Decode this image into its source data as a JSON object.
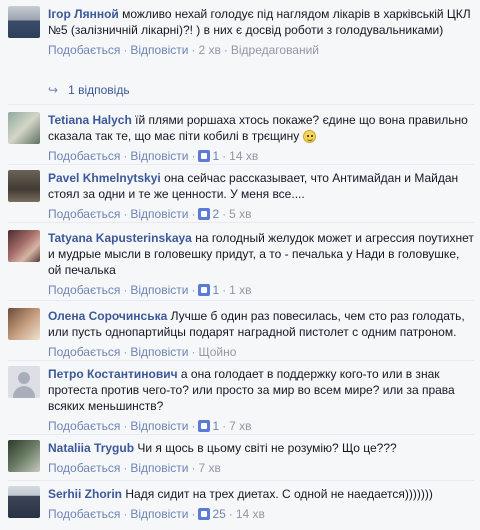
{
  "labels": {
    "like": "Подобається",
    "reply": "Відповісти",
    "dot": "·",
    "edited": "Відредагований"
  },
  "replies_link": "1 відповідь",
  "comments": [
    {
      "author": "Ігор Лянной",
      "text": "можливо нехай голодує під наглядом лікарів в харківській ЦКЛ №5 (залізничній лікарні)?! ) в них є досвід роботи з голодувальниками)",
      "time": "2 хв",
      "likes": "",
      "edited": true
    },
    {
      "author": "Tetiana Halych",
      "text": "їй плями роршаха хтось покаже? єдине що вона правильно сказала так те, що має піти кобилі в трєщину",
      "emoji": "smile-emoji",
      "time": "14 хв",
      "likes": "1"
    },
    {
      "author": "Pavel Khmelnytskyi",
      "text": "она сейчас рассказывает, что Антимайдан и Майдан стоял за одни и те же ценности. У меня все....",
      "time": "5 хв",
      "likes": "2"
    },
    {
      "author": "Tatyana Kapusterinskaya",
      "text": "на голодный желудок может и агрессия поутихнет и мудрые мысли в головешку придут, а то - печалька у Нади в головушке, ой печалька",
      "time": "1 хв",
      "likes": "1"
    },
    {
      "author": "Олена Сорочинська",
      "text": "Лучше б один раз повесилась, чем сто раз голодать, или пусть однопартийцы подарят наградной пистолет с одним патроном.",
      "time": "Щойно",
      "likes": ""
    },
    {
      "author": "Петро Костантинович",
      "text": "а она голодает в поддержку кого-то или в знак протеста против чего-то? или просто за мир во всем мире? или за права всяких меньшинств?",
      "time": "7 хв",
      "likes": "1"
    },
    {
      "author": "Nataliia Trygub",
      "text": "Чи я щось в цьому світі не розумію? Що це???",
      "time": "7 хв",
      "likes": ""
    },
    {
      "author": "Serhii Zhorin",
      "text": "Надя сидит на трех диетах. С одной не наедается)))))))",
      "time": "14 хв",
      "likes": "25"
    }
  ],
  "colors": {
    "background": "#f6f7f9",
    "author": "#3b5998",
    "action_link": "#6d84b4",
    "meta": "#9197a3"
  }
}
